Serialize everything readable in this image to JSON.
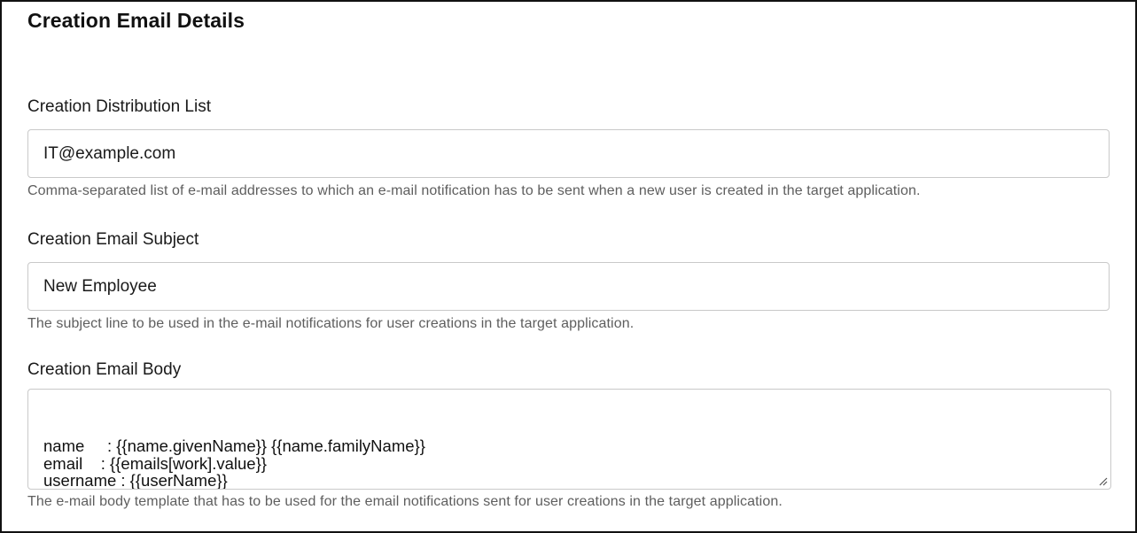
{
  "section": {
    "title": "Creation Email Details"
  },
  "distribution_list": {
    "label": "Creation Distribution List",
    "value": "IT@example.com",
    "help": "Comma-separated list of e-mail addresses to which an e-mail notification has to be sent when a new user is created in the target application."
  },
  "email_subject": {
    "label": "Creation Email Subject",
    "value": "New Employee",
    "help": "The subject line to be used in the e-mail notifications for user creations in the target application."
  },
  "email_body": {
    "label": "Creation Email Body",
    "value": "name     : {{name.givenName}} {{name.familyName}}\nemail    : {{emails[work].value}}\nusername : {{userName}}\npassword : {{password}}",
    "help": "The e-mail body template that has to be used for the email notifications sent for user creations in the target application.",
    "resize_icon": "resize-grip-icon"
  }
}
